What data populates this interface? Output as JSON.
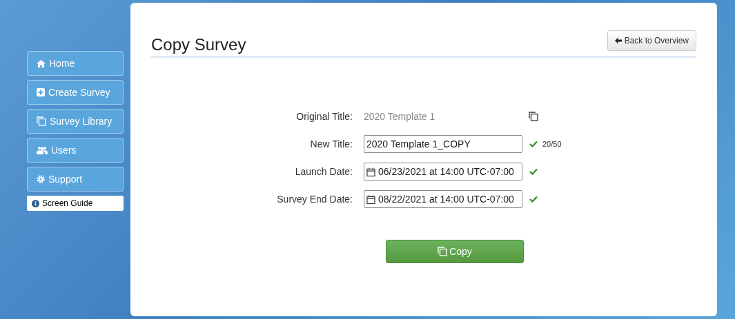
{
  "sidebar": {
    "items": [
      {
        "label": "Home"
      },
      {
        "label": "Create Survey"
      },
      {
        "label": "Survey Library"
      },
      {
        "label": "Users"
      },
      {
        "label": "Support"
      }
    ],
    "guide": "Screen Guide"
  },
  "page": {
    "title": "Copy Survey",
    "back_button": "Back to Overview"
  },
  "form": {
    "original": {
      "label": "Original Title:",
      "value": "2020 Template 1"
    },
    "fields": [
      {
        "kind": "text",
        "label": "New Title:",
        "value": "2020 Template 1_COPY",
        "valid": true,
        "count": "20/50"
      },
      {
        "kind": "date",
        "label": "Launch Date:",
        "value": "06/23/2021 at 14:00 UTC-07:00",
        "valid": true
      },
      {
        "kind": "date",
        "label": "Survey End Date:",
        "value": "08/22/2021 at 14:00 UTC-07:00",
        "valid": true
      }
    ],
    "submit": "Copy"
  }
}
